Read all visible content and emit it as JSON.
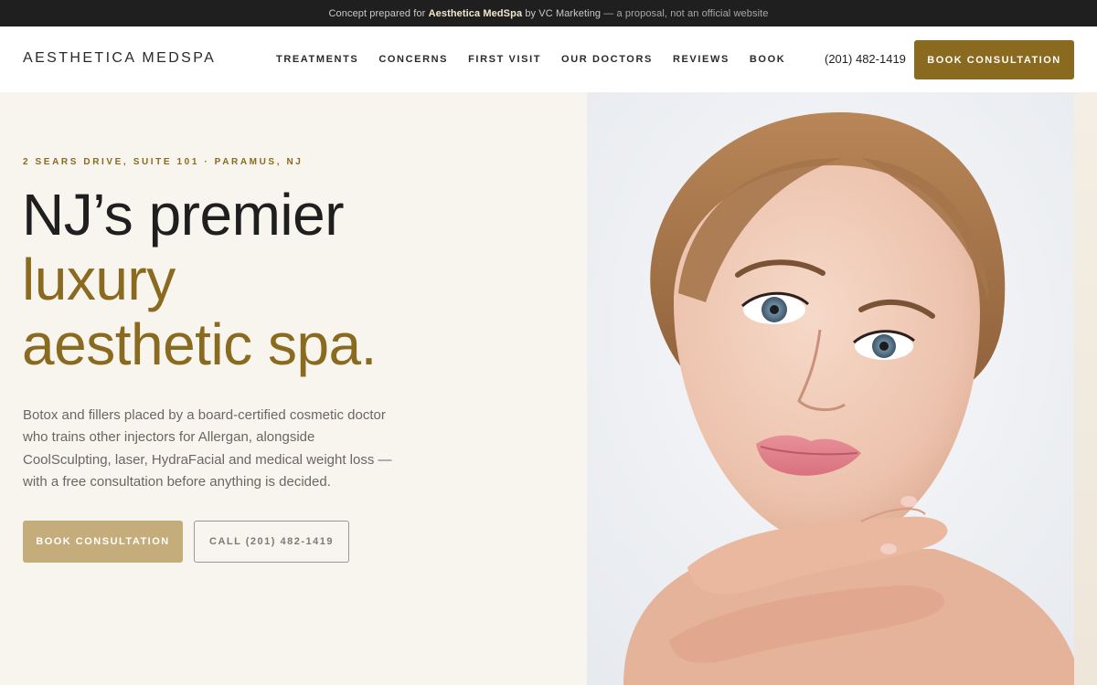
{
  "topbar": {
    "prefix": "Concept prepared for",
    "client": "Aesthetica MedSpa",
    "by": "by VC Marketing",
    "note": "— a proposal, not an official website"
  },
  "header": {
    "logo": "AESTHETICA MEDSPA",
    "nav": [
      "TREATMENTS",
      "CONCERNS",
      "FIRST VISIT",
      "OUR DOCTORS",
      "REVIEWS",
      "BOOK"
    ],
    "phone": "(201) 482-1419",
    "cta": "BOOK CONSULTATION"
  },
  "hero": {
    "address": "2 SEARS DRIVE, SUITE 101 · PARAMUS, NJ",
    "headline_line1": "NJ’s premier",
    "headline_line2": "luxury",
    "headline_line3": "aesthetic spa.",
    "lede": "Botox and fillers placed by a board-certified cosmetic doctor who trains other injectors for Allergan, alongside CoolSculpting, laser, HydraFacial and medical weight loss — with a free consultation before anything is decided.",
    "primary_button": "BOOK CONSULTATION",
    "secondary_button": "CALL (201) 482-1419"
  },
  "colors": {
    "accent": "#8a6a1f",
    "accent_light": "#c4ad7a",
    "topbar_bg": "#1f1f1f",
    "page_bg": "#f8f4ee"
  }
}
